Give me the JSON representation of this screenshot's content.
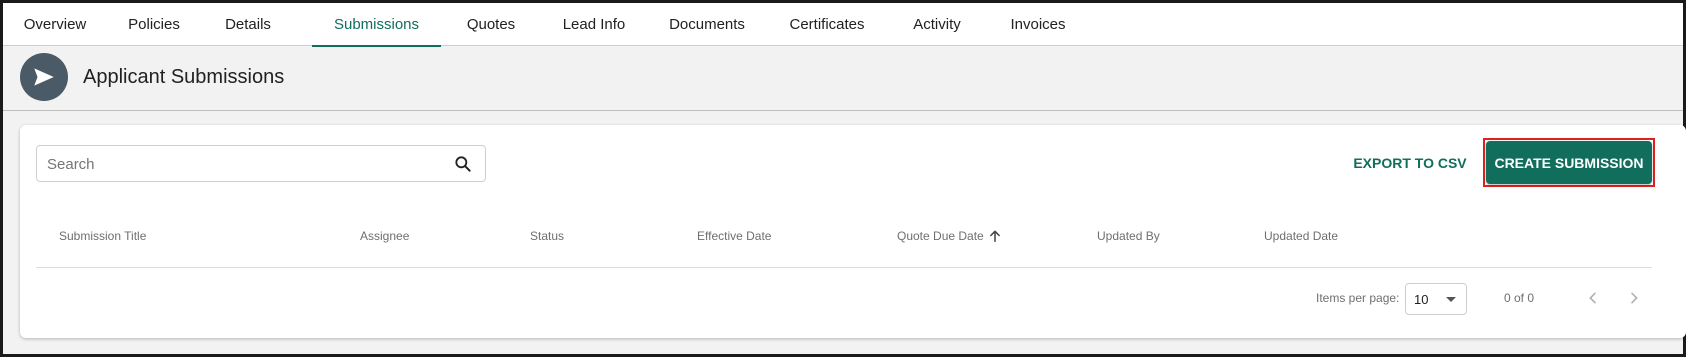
{
  "tabs": [
    {
      "label": "Overview"
    },
    {
      "label": "Policies"
    },
    {
      "label": "Details"
    },
    {
      "label": "Submissions",
      "active": true
    },
    {
      "label": "Quotes"
    },
    {
      "label": "Lead Info"
    },
    {
      "label": "Documents"
    },
    {
      "label": "Certificates"
    },
    {
      "label": "Activity"
    },
    {
      "label": "Invoices"
    }
  ],
  "header": {
    "icon": "send-icon",
    "title": "Applicant Submissions"
  },
  "search": {
    "placeholder": "Search",
    "value": ""
  },
  "actions": {
    "export_label": "EXPORT TO CSV",
    "create_label": "CREATE SUBMISSION"
  },
  "table": {
    "columns": [
      {
        "label": "Submission Title"
      },
      {
        "label": "Assignee"
      },
      {
        "label": "Status"
      },
      {
        "label": "Effective Date"
      },
      {
        "label": "Quote Due Date",
        "sort": "ascending"
      },
      {
        "label": "Updated By"
      },
      {
        "label": "Updated Date"
      }
    ],
    "rows": []
  },
  "pagination": {
    "items_per_page_label": "Items per page:",
    "items_per_page": "10",
    "range_label": "0 of 0"
  },
  "colors": {
    "accent": "#116e5c",
    "highlight_outline": "#e0201c",
    "header_icon_bg": "#4a5a66"
  }
}
